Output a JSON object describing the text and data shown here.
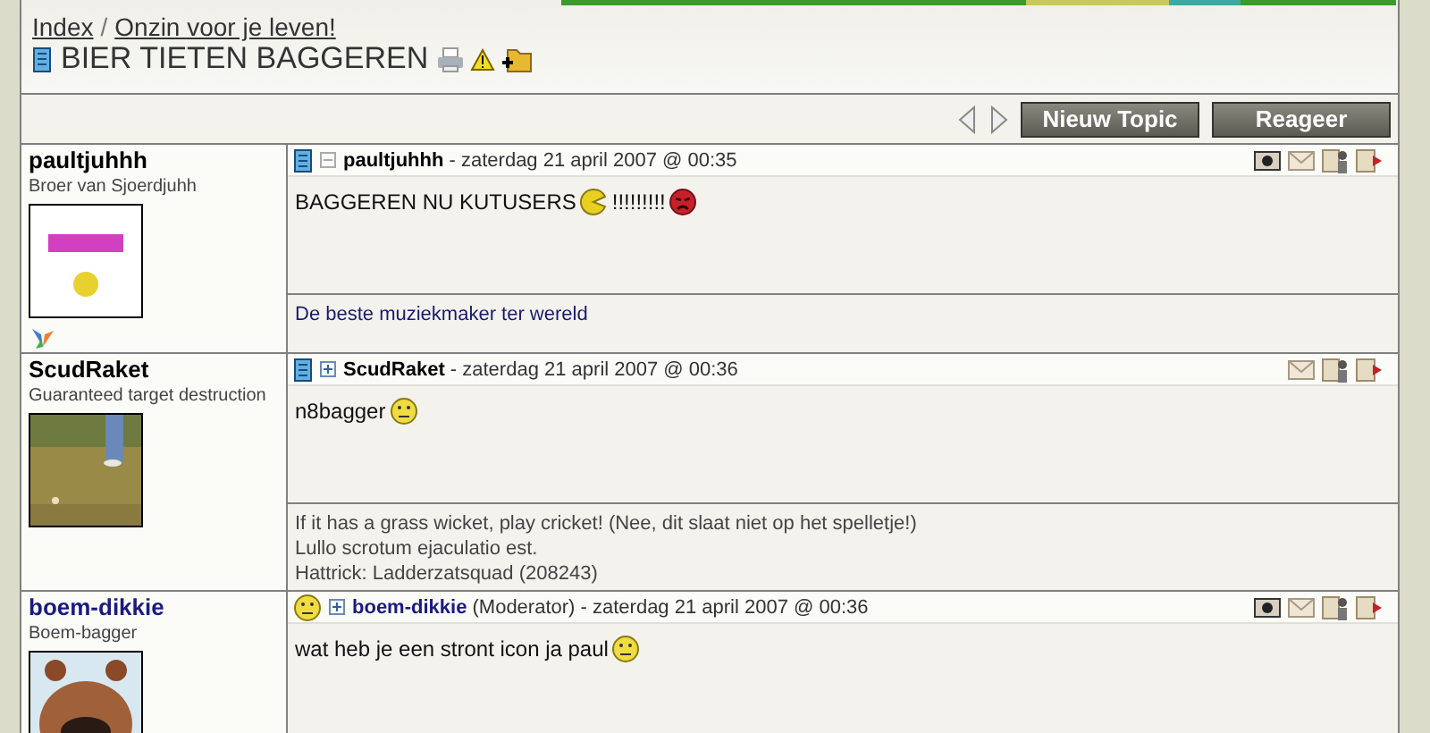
{
  "banner": {
    "kind": "picture"
  },
  "breadcrumb": [
    {
      "label": "Index"
    },
    {
      "label": "Onzin voor je leven!"
    }
  ],
  "breadcrumb_separator": "/",
  "topic_title": "BIER TIETEN BAGGEREN",
  "toolbar": {
    "buttons": [
      "Nieuw Topic",
      "Reageer"
    ]
  },
  "posts": [
    {
      "kind": "document",
      "author": "paultjuhhh",
      "color": "#000000",
      "author_title": "Broer van Sjoerdjuhh",
      "avatar": {
        "kind": "picture"
      },
      "online_icon": true,
      "expanded": true,
      "header_author": "paultjuhhh",
      "date": "- zaterdag 21 april 2007 @ 00:35",
      "camera_link": true,
      "body": [
        {
          "kind": "text",
          "text": "BAGGEREN NU KUTUSERS"
        },
        {
          "kind": "chomp"
        },
        {
          "kind": "text",
          "text": "!!!!!!!!!"
        },
        {
          "kind": "angry"
        }
      ],
      "signature": [
        "De beste muziekmaker ter wereld"
      ]
    },
    {
      "kind": "document",
      "author": "ScudRaket",
      "color": "#000000",
      "author_title": "Guaranteed target destruction",
      "avatar": {
        "kind": "picture"
      },
      "online_icon": false,
      "expanded": false,
      "header_author": "ScudRaket",
      "date": "- zaterdag 21 april 2007 @ 00:36",
      "camera_link": false,
      "body": [
        {
          "kind": "text",
          "text": "n8bagger"
        },
        {
          "kind": "neutral"
        }
      ],
      "signature": [
        "If it has a grass wicket, play cricket! (Nee, dit slaat niet op het spelletje!)",
        "Lullo scrotum ejaculatio est.",
        "Hattrick: Ladderzatsquad (208243)"
      ]
    },
    {
      "kind": "smiley",
      "author": "boem-dikkie",
      "color": "#1a1a80",
      "author_title": "Boem-bagger",
      "role": "(Moderator)",
      "avatar": {
        "kind": "picture"
      },
      "online_icon": false,
      "expanded": false,
      "header_author": "boem-dikkie",
      "date": "- zaterdag 21 april 2007 @ 00:36",
      "camera_link": true,
      "body": [
        {
          "kind": "text",
          "text": "wat heb je een stront icon ja paul"
        },
        {
          "kind": "neutral"
        }
      ]
    }
  ]
}
